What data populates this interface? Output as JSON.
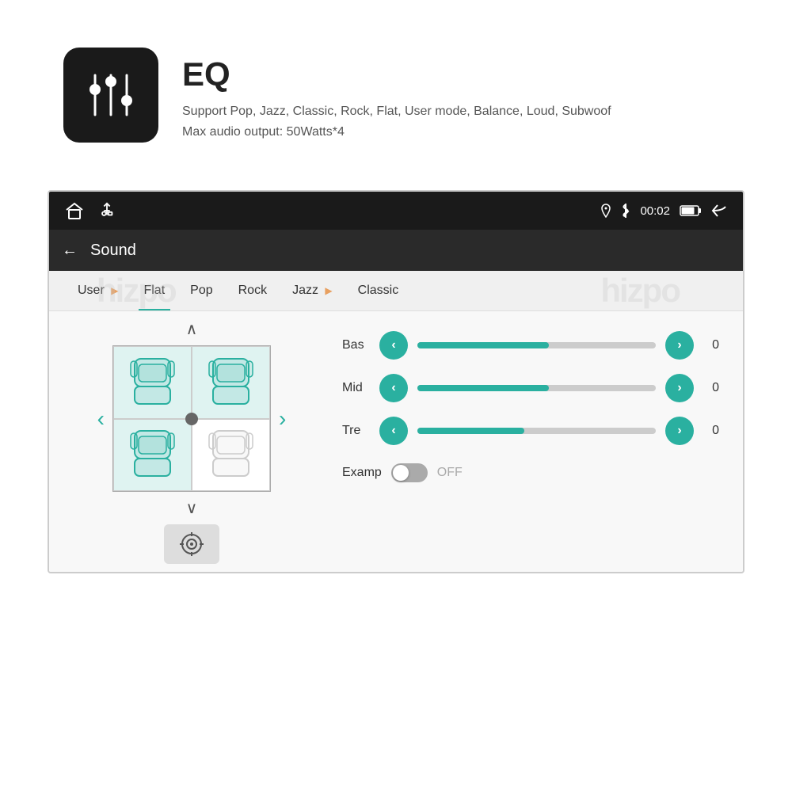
{
  "eq_section": {
    "title": "EQ",
    "description_line1": "Support Pop, Jazz, Classic, Rock, Flat, User mode, Balance, Loud, Subwoof",
    "description_line2": "Max audio output: 50Watts*4"
  },
  "status_bar": {
    "time": "00:02",
    "icons": [
      "location",
      "bluetooth",
      "window",
      "back"
    ]
  },
  "nav": {
    "back_label": "←",
    "title": "Sound"
  },
  "eq_modes": [
    {
      "label": "User",
      "active": false,
      "has_play": true
    },
    {
      "label": "Flat",
      "active": true,
      "has_play": false
    },
    {
      "label": "Pop",
      "active": false,
      "has_play": false
    },
    {
      "label": "Rock",
      "active": false,
      "has_play": false
    },
    {
      "label": "Jazz",
      "active": false,
      "has_play": true
    },
    {
      "label": "Classic",
      "active": false,
      "has_play": false
    }
  ],
  "eq_controls": [
    {
      "label": "Bas",
      "value": "0",
      "fill_percent": 55
    },
    {
      "label": "Mid",
      "value": "0",
      "fill_percent": 55
    },
    {
      "label": "Tre",
      "value": "0",
      "fill_percent": 45
    }
  ],
  "examp": {
    "label": "Examp",
    "state": "OFF"
  },
  "watermarks": [
    "hizpo",
    "hizpo"
  ],
  "arrows": {
    "up": "∧",
    "down": "∨",
    "left": "<",
    "right": ">"
  }
}
